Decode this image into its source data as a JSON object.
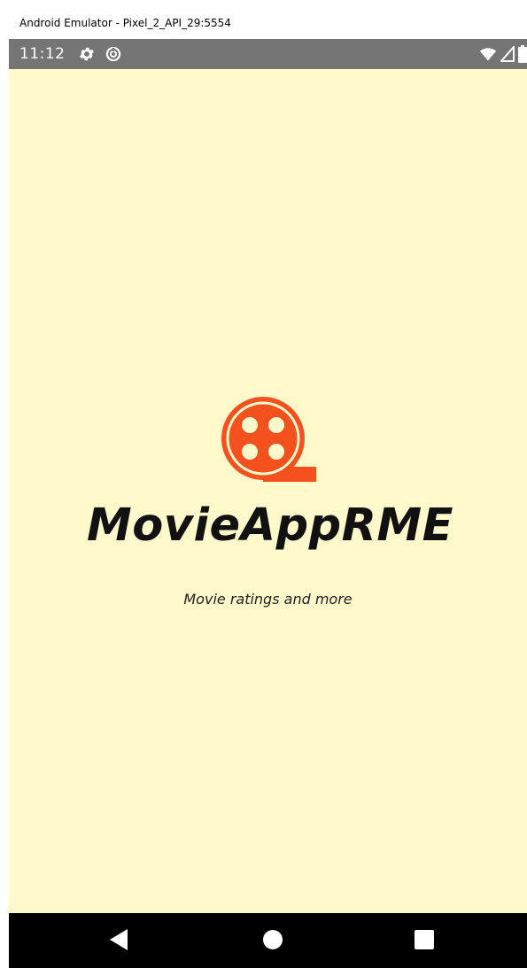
{
  "window": {
    "title": "Android Emulator - Pixel_2_API_29:5554"
  },
  "statusbar": {
    "time": "11:12",
    "left_icons": [
      "settings-gear-icon",
      "data-saver-icon"
    ],
    "right_icons": [
      "wifi-icon",
      "cell-signal-icon",
      "battery-icon"
    ]
  },
  "splash": {
    "app_name": "MovieAppRME",
    "tagline": "Movie ratings and more",
    "logo_icon": "film-reel-icon"
  },
  "navigation": {
    "buttons": [
      "back-icon",
      "home-icon",
      "recents-icon"
    ]
  },
  "colors": {
    "background": "#fff9cc",
    "accent": "#f4511e",
    "statusbar": "#757575",
    "navbar": "#000000",
    "text": "#111111"
  }
}
